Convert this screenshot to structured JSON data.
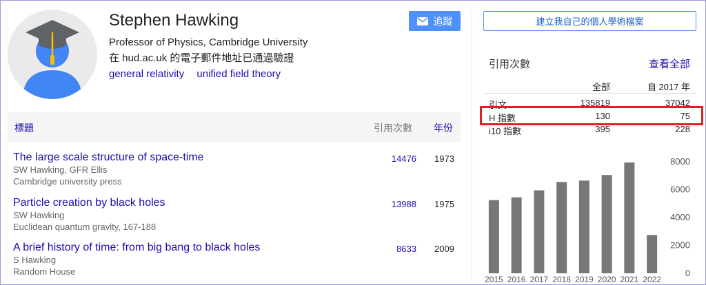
{
  "profile": {
    "name": "Stephen Hawking",
    "affiliation": "Professor of Physics, Cambridge University",
    "verified": "在 hud.ac.uk 的電子郵件地址已通過驗證",
    "interests": [
      "general relativity",
      "unified field theory"
    ]
  },
  "follow_button": {
    "label": "追蹤",
    "icon": "mail-icon"
  },
  "table": {
    "headers": {
      "title": "標題",
      "cites": "引用次數",
      "year": "年份"
    },
    "rows": [
      {
        "title": "The large scale structure of space-time",
        "authors": "SW Hawking, GFR Ellis",
        "venue": "Cambridge university press",
        "cites": "14476",
        "year": "1973"
      },
      {
        "title": "Particle creation by black holes",
        "authors": "SW Hawking",
        "venue": "Euclidean quantum gravity, 167-188",
        "cites": "13988",
        "year": "1975"
      },
      {
        "title": "A brief history of time: from big bang to black holes",
        "authors": "S Hawking",
        "venue": "Random House",
        "cites": "8633",
        "year": "2009"
      }
    ]
  },
  "right_panel": {
    "create_button": "建立我自己的個人學術檔案",
    "cited_by": "引用次數",
    "view_all": "查看全部",
    "stats_headers": {
      "all": "全部",
      "since": "自 2017 年"
    },
    "stats": [
      {
        "label": "引文",
        "all": "135819",
        "since": "37042"
      },
      {
        "label": "H 指數",
        "all": "130",
        "since": "75"
      },
      {
        "label": "i10 指數",
        "all": "395",
        "since": "228"
      }
    ]
  },
  "colors": {
    "link": "#1a0dab",
    "button_blue": "#4d90fe",
    "highlight": "#e02020",
    "bar": "#777777"
  },
  "chart_data": {
    "type": "bar",
    "categories": [
      "2015",
      "2016",
      "2017",
      "2018",
      "2019",
      "2020",
      "2021",
      "2022"
    ],
    "values": [
      5250,
      5450,
      5950,
      6550,
      6650,
      7050,
      7950,
      2750
    ],
    "ylim": [
      0,
      8000
    ],
    "yticks": [
      0,
      2000,
      4000,
      6000,
      8000
    ],
    "axis_side": "right",
    "grid": false,
    "title": "",
    "xlabel": "",
    "ylabel": ""
  }
}
